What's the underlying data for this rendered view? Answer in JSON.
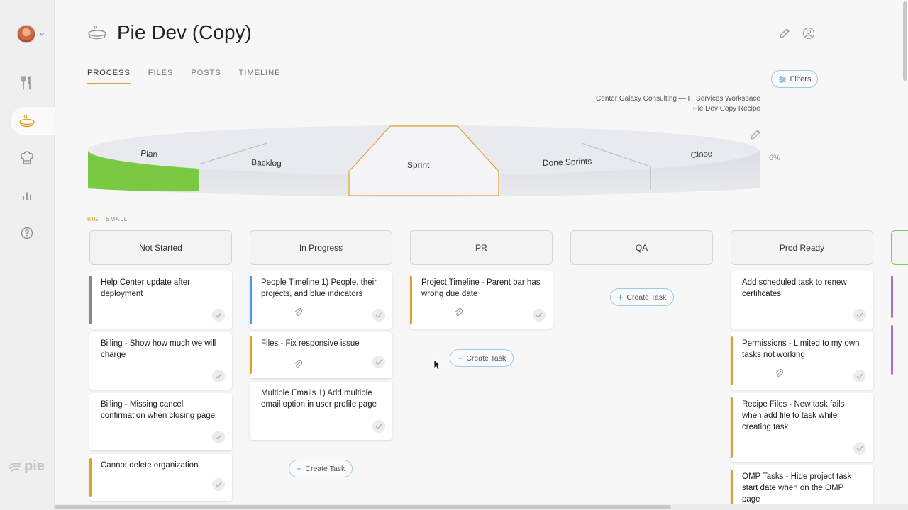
{
  "project": {
    "title": "Pie Dev (Copy)"
  },
  "tabs": [
    {
      "label": "PROCESS",
      "active": true
    },
    {
      "label": "FILES",
      "active": false
    },
    {
      "label": "POSTS",
      "active": false
    },
    {
      "label": "TIMELINE",
      "active": false
    }
  ],
  "filters_label": "Filters",
  "workspace": {
    "line1": "Center Galaxy Consulting — IT Services Workspace",
    "line2": "Pie Dev Copy Recipe"
  },
  "pie": {
    "segments": [
      "Plan",
      "Backlog",
      "Sprint",
      "Done Sprints",
      "Close"
    ],
    "active_segment": "Sprint",
    "progress_label": "6%",
    "progress_fill": 0.06,
    "colors": {
      "progress": "#7ac943",
      "active_outline": "#e0a030"
    }
  },
  "size_toggle": {
    "big": "BIG",
    "small": "SMALL",
    "selected": "BIG"
  },
  "columns": [
    {
      "name": "Not Started",
      "cards": [
        {
          "title": "Help Center update after deployment",
          "bar_color": "#888888",
          "attachment": false
        },
        {
          "title": "Billing - Show how much we will charge",
          "bar_color": "",
          "attachment": false
        },
        {
          "title": "Billing - Missing cancel confirmation when closing page",
          "bar_color": "",
          "attachment": false
        },
        {
          "title": "Cannot delete organization",
          "bar_color": "#e0a030",
          "attachment": false
        }
      ],
      "create_label": ""
    },
    {
      "name": "In Progress",
      "cards": [
        {
          "title": "People Timeline 1) People, their projects, and blue indicators",
          "bar_color": "#4a9fd8",
          "attachment": true
        },
        {
          "title": "Files - Fix responsive issue",
          "bar_color": "#e0a030",
          "attachment": true
        },
        {
          "title": "Multiple Emails 1) Add multiple email option in user profile page",
          "bar_color": "",
          "attachment": false
        }
      ],
      "create_label": "Create Task"
    },
    {
      "name": "PR",
      "cards": [
        {
          "title": "Project Timeline - Parent bar has wrong due date",
          "bar_color": "#e0a030",
          "attachment": true
        }
      ],
      "create_label": "Create Task"
    },
    {
      "name": "QA",
      "cards": [],
      "create_label": "Create Task"
    },
    {
      "name": "Prod Ready",
      "cards": [
        {
          "title": "Add scheduled task to renew certificates",
          "bar_color": "",
          "attachment": false
        },
        {
          "title": "Permissions - Limited to my own tasks not working",
          "bar_color": "#e0a030",
          "attachment": true
        },
        {
          "title": "Recipe Files - New task fails when add file to task while creating task",
          "bar_color": "#e0a030",
          "attachment": false
        },
        {
          "title": "OMP Tasks - Hide project task start date when on the OMP page",
          "bar_color": "#e0a030",
          "attachment": false
        }
      ],
      "create_label": ""
    }
  ],
  "sidebar": {
    "items": [
      "recipes-icon",
      "pie-icon",
      "chef-hat-icon",
      "reports-icon",
      "help-icon"
    ],
    "active": "pie-icon",
    "logo": "pie"
  }
}
